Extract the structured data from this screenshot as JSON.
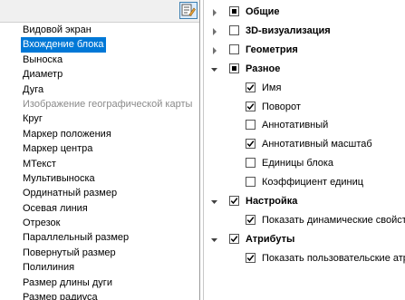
{
  "object_list": {
    "items": [
      {
        "label": "Видовой экран",
        "state": "normal"
      },
      {
        "label": "Вхождение блока",
        "state": "selected"
      },
      {
        "label": "Выноска",
        "state": "normal"
      },
      {
        "label": "Диаметр",
        "state": "normal"
      },
      {
        "label": "Дуга",
        "state": "normal"
      },
      {
        "label": "Изображение географической карты",
        "state": "disabled"
      },
      {
        "label": "Круг",
        "state": "normal"
      },
      {
        "label": "Маркер положения",
        "state": "normal"
      },
      {
        "label": "Маркер центра",
        "state": "normal"
      },
      {
        "label": "МТекст",
        "state": "normal"
      },
      {
        "label": "Мультивыноска",
        "state": "normal"
      },
      {
        "label": "Ординатный размер",
        "state": "normal"
      },
      {
        "label": "Осевая линия",
        "state": "normal"
      },
      {
        "label": "Отрезок",
        "state": "normal"
      },
      {
        "label": "Параллельный размер",
        "state": "normal"
      },
      {
        "label": "Повернутый размер",
        "state": "normal"
      },
      {
        "label": "Полилиния",
        "state": "normal"
      },
      {
        "label": "Размер длины дуги",
        "state": "normal"
      },
      {
        "label": "Размер радиуса",
        "state": "normal"
      }
    ]
  },
  "property_tree": {
    "groups": [
      {
        "label": "Общие",
        "check": "partial",
        "expanded": false,
        "children": []
      },
      {
        "label": "3D-визуализация",
        "check": "unchecked",
        "expanded": false,
        "children": []
      },
      {
        "label": "Геометрия",
        "check": "unchecked",
        "expanded": false,
        "children": []
      },
      {
        "label": "Разное",
        "check": "partial",
        "expanded": true,
        "children": [
          {
            "label": "Имя",
            "check": "checked"
          },
          {
            "label": "Поворот",
            "check": "checked"
          },
          {
            "label": "Аннотативный",
            "check": "unchecked"
          },
          {
            "label": "Аннотативный масштаб",
            "check": "checked"
          },
          {
            "label": "Единицы блока",
            "check": "unchecked"
          },
          {
            "label": "Коэффициент единиц",
            "check": "unchecked"
          }
        ]
      },
      {
        "label": "Настройка",
        "check": "checked",
        "expanded": true,
        "children": [
          {
            "label": "Показать динамические свойства",
            "check": "checked"
          }
        ]
      },
      {
        "label": "Атрибуты",
        "check": "checked",
        "expanded": true,
        "children": [
          {
            "label": "Показать пользовательские атрибуты",
            "check": "checked"
          }
        ]
      }
    ]
  },
  "icons": {
    "toolbar_button": "edit-list-icon",
    "collapsed": "triangle-right-icon",
    "expanded": "triangle-down-icon"
  },
  "colors": {
    "selection": "#0078d7",
    "disabled_text": "#8a8a8a"
  }
}
